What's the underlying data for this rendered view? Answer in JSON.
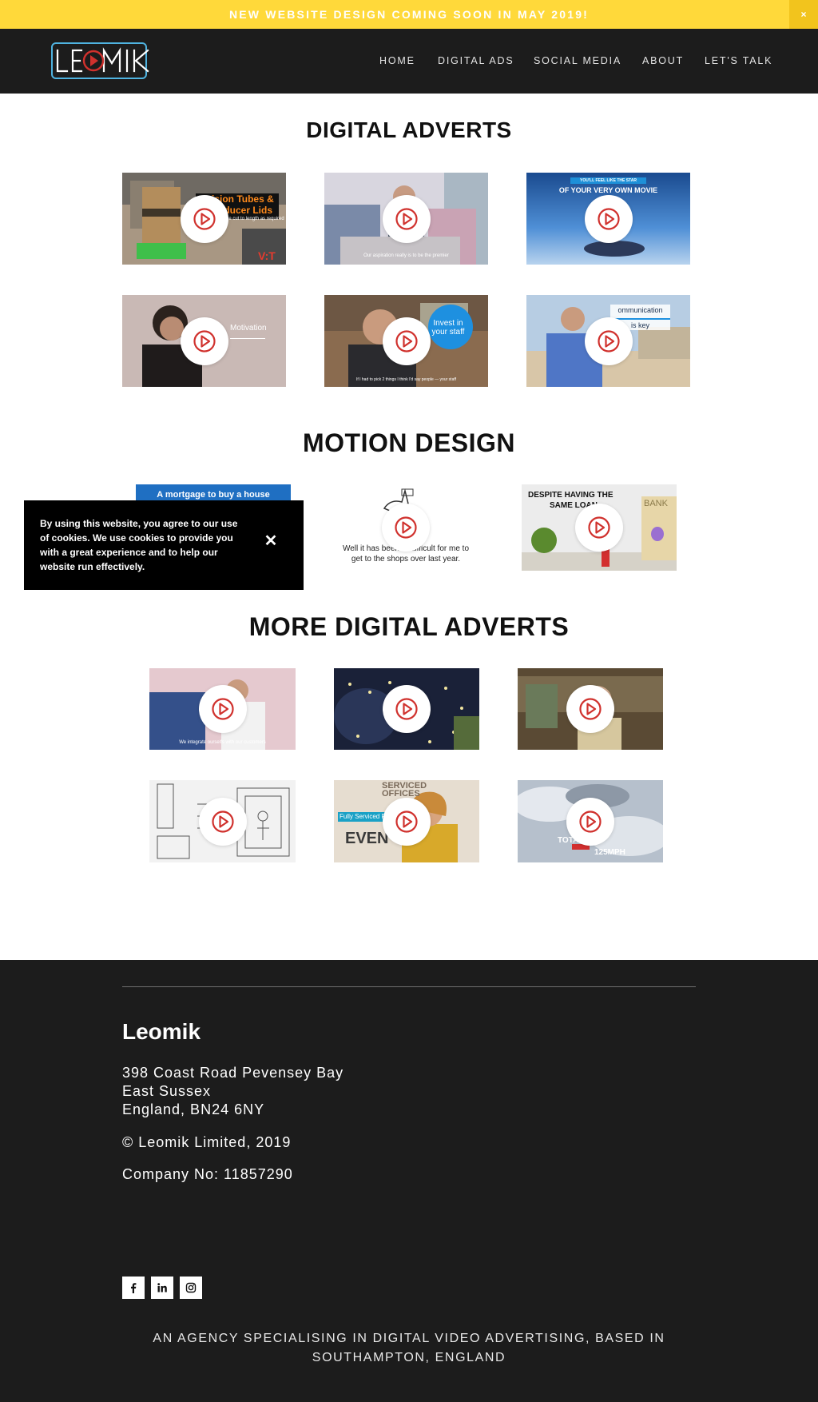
{
  "announcement": {
    "text": "NEW WEBSITE DESIGN COMING SOON IN MAY 2019!",
    "close_label": "×",
    "bg_color": "#ffd93a"
  },
  "header": {
    "logo_text": "LEOMIK",
    "nav": [
      {
        "label": "HOME"
      },
      {
        "label": "DIGITAL ADS"
      },
      {
        "label": "SOCIAL MEDIA"
      },
      {
        "label": "ABOUT"
      },
      {
        "label": "LET'S TALK"
      }
    ]
  },
  "sections": [
    {
      "title": "DIGITAL ADVERTS",
      "videos": [
        {
          "overlay": [
            "ision Tubes &",
            "Reducer Lids"
          ],
          "caption": "be cut to length as required",
          "badge": "V:T",
          "icon": "play-icon"
        },
        {
          "caption": "Our aspiration really is to be the premier",
          "icon": "play-icon"
        },
        {
          "overlay": [
            "YOU'LL FEEL LIKE THE STAR",
            "OF YOUR VERY OWN MOVIE"
          ],
          "icon": "play-icon"
        },
        {
          "overlay": [
            "Motivation"
          ],
          "icon": "play-icon"
        },
        {
          "overlay": [
            "Invest in",
            "your staff"
          ],
          "caption": "If I had to pick 2 things I think I'd say people — your staff",
          "icon": "play-icon"
        },
        {
          "overlay": [
            "ommunication",
            "is key"
          ],
          "icon": "play-icon"
        }
      ]
    },
    {
      "title": "MOTION DESIGN",
      "videos": [
        {
          "overlay": [
            "A mortgage to buy a house"
          ],
          "icon": "play-icon"
        },
        {
          "caption": "Well it has been ... difficult for me to get to the shops over last year.",
          "icon": "play-icon"
        },
        {
          "overlay": [
            "DESPITE HAVING THE",
            "SAME LOAN",
            "BANK"
          ],
          "icon": "play-icon"
        }
      ]
    },
    {
      "title": "MORE DIGITAL ADVERTS",
      "videos": [
        {
          "caption": "We integrate ourselfs with our customers",
          "icon": "play-icon"
        },
        {
          "icon": "play-icon"
        },
        {
          "icon": "play-icon"
        },
        {
          "icon": "play-icon"
        },
        {
          "overlay": [
            "SERVICED",
            "OFFICES",
            "Fully Serviced Pr",
            "EVEN"
          ],
          "icon": "play-icon"
        },
        {
          "overlay": [
            "TOTAL",
            "125MPH"
          ],
          "icon": "play-icon"
        }
      ]
    }
  ],
  "cookie_notice": {
    "text": "By using this website, you agree to our use of cookies. We use cookies to provide you with a great experience and to help our website run effectively.",
    "close_label": "✕"
  },
  "footer": {
    "brand": "Leomik",
    "address": [
      "398 Coast Road Pevensey Bay",
      "East Sussex",
      "England, BN24 6NY"
    ],
    "copyright": "© Leomik Limited, 2019",
    "company_no": "Company No: 11857290",
    "social": [
      {
        "icon": "facebook-icon"
      },
      {
        "icon": "linkedin-icon"
      },
      {
        "icon": "instagram-icon"
      }
    ],
    "tagline": [
      "AN AGENCY SPECIALISING IN DIGITAL VIDEO ADVERTISING, BASED IN",
      "SOUTHAMPTON, ENGLAND"
    ]
  },
  "colors": {
    "accent": "#ffd93a",
    "dark": "#1c1c1c",
    "play_red": "#d0312d",
    "logo_blue": "#4fb3e0"
  }
}
